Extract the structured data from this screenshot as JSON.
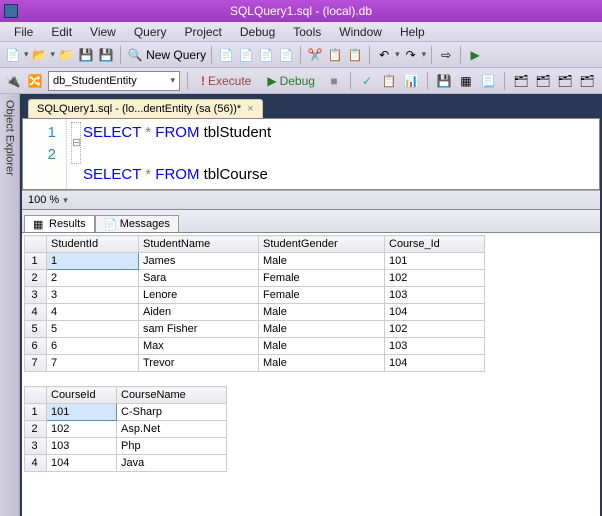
{
  "title": "SQLQuery1.sql - (local).db",
  "menu": {
    "file": "File",
    "edit": "Edit",
    "view": "View",
    "query": "Query",
    "project": "Project",
    "debug": "Debug",
    "tools": "Tools",
    "window": "Window",
    "help": "Help"
  },
  "toolbar": {
    "newquery": "New Query",
    "db": "db_StudentEntity",
    "execute": "Execute",
    "debug": "Debug"
  },
  "sidebar": {
    "objexp": "Object Explorer"
  },
  "tab": {
    "name": "SQLQuery1.sql - (lo...dentEntity (sa (56))*",
    "close": "×"
  },
  "gutter": {
    "l1": "1",
    "l2": "2"
  },
  "code": {
    "l1_select": "SELECT",
    "l1_star": " * ",
    "l1_from": "FROM",
    "l1_tbl": " tblStudent",
    "l2_select": "SELECT",
    "l2_star": " * ",
    "l2_from": "FROM",
    "l2_tbl": " tblCourse"
  },
  "zoom": {
    "value": "100 %"
  },
  "resultTabs": {
    "results": "Results",
    "messages": "Messages"
  },
  "grid1": {
    "headers": {
      "c0": "",
      "c1": "StudentId",
      "c2": "StudentName",
      "c3": "StudentGender",
      "c4": "Course_Id"
    },
    "rows": [
      {
        "n": "1",
        "c1": "1",
        "c2": "James",
        "c3": "Male",
        "c4": "101"
      },
      {
        "n": "2",
        "c1": "2",
        "c2": "Sara",
        "c3": "Female",
        "c4": "102"
      },
      {
        "n": "3",
        "c1": "3",
        "c2": "Lenore",
        "c3": "Female",
        "c4": "103"
      },
      {
        "n": "4",
        "c1": "4",
        "c2": "Aiden",
        "c3": "Male",
        "c4": "104"
      },
      {
        "n": "5",
        "c1": "5",
        "c2": "sam Fisher",
        "c3": "Male",
        "c4": "102"
      },
      {
        "n": "6",
        "c1": "6",
        "c2": "Max",
        "c3": "Male",
        "c4": "103"
      },
      {
        "n": "7",
        "c1": "7",
        "c2": "Trevor",
        "c3": "Male",
        "c4": "104"
      }
    ]
  },
  "grid2": {
    "headers": {
      "c0": "",
      "c1": "CourseId",
      "c2": "CourseName"
    },
    "rows": [
      {
        "n": "1",
        "c1": "101",
        "c2": "C-Sharp"
      },
      {
        "n": "2",
        "c1": "102",
        "c2": "Asp.Net"
      },
      {
        "n": "3",
        "c1": "103",
        "c2": "Php"
      },
      {
        "n": "4",
        "c1": "104",
        "c2": "Java"
      }
    ]
  }
}
